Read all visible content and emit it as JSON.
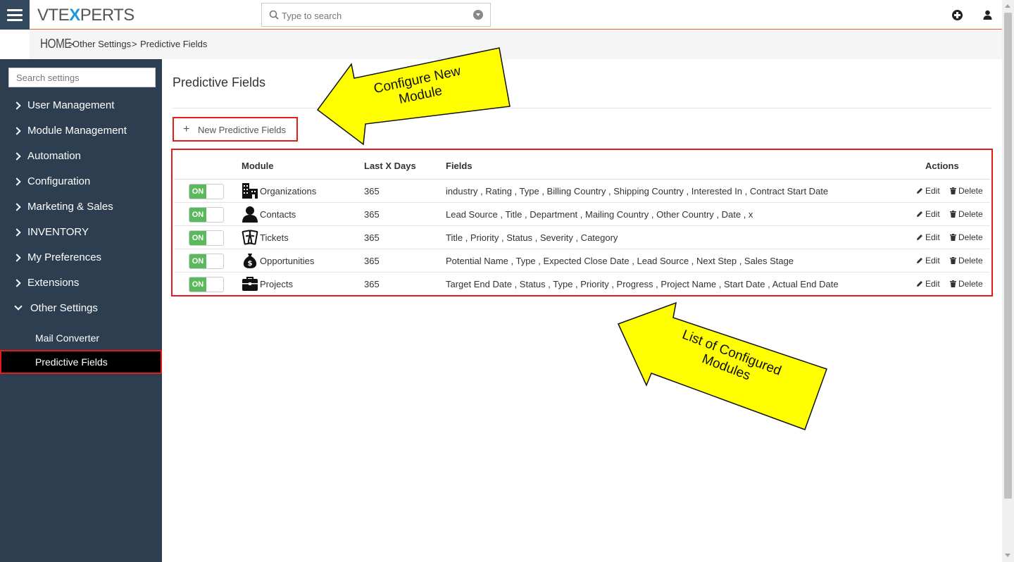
{
  "app": {
    "logo_left": "VTE",
    "logo_x": "X",
    "logo_right": "PERTS"
  },
  "search": {
    "placeholder": "Type to search"
  },
  "breadcrumb": {
    "home": "HOME",
    "sep": ">",
    "items": [
      "Other Settings",
      "Predictive Fields"
    ]
  },
  "sidebar": {
    "search_placeholder": "Search settings",
    "items": [
      {
        "label": "User Management"
      },
      {
        "label": "Module Management"
      },
      {
        "label": "Automation"
      },
      {
        "label": "Configuration"
      },
      {
        "label": "Marketing & Sales"
      },
      {
        "label": "INVENTORY"
      },
      {
        "label": "My Preferences"
      },
      {
        "label": "Extensions"
      },
      {
        "label": "Other Settings"
      }
    ],
    "subitems": [
      {
        "label": "Mail Converter"
      },
      {
        "label": "Predictive Fields"
      }
    ]
  },
  "main": {
    "title": "Predictive Fields",
    "new_button_icon": "+",
    "new_button": "New Predictive Fields",
    "columns": [
      "Module",
      "Last X Days",
      "Fields",
      "Actions"
    ],
    "rows": [
      {
        "status": "ON",
        "icon": "building-icon",
        "module": "Organizations",
        "days": "365",
        "fields": "industry , Rating , Type , Billing Country , Shipping Country , Interested In , Contract Start Date"
      },
      {
        "status": "ON",
        "icon": "person-icon",
        "module": "Contacts",
        "days": "365",
        "fields": "Lead Source , Title , Department , Mailing Country , Other Country , Date , x"
      },
      {
        "status": "ON",
        "icon": "ticket-icon",
        "module": "Tickets",
        "days": "365",
        "fields": "Title , Priority , Status , Severity , Category"
      },
      {
        "status": "ON",
        "icon": "money-bag-icon",
        "module": "Opportunities",
        "days": "365",
        "fields": "Potential Name , Type , Expected Close Date , Lead Source , Next Step , Sales Stage"
      },
      {
        "status": "ON",
        "icon": "briefcase-icon",
        "module": "Projects",
        "days": "365",
        "fields": "Target End Date , Status , Type , Priority , Progress , Project Name , Start Date , Actual End Date"
      }
    ],
    "edit_label": "Edit",
    "delete_label": "Delete"
  },
  "callouts": {
    "top_line1": "Configure New",
    "top_line2": "Module",
    "bottom_line1": "List of Configured",
    "bottom_line2": "Modules"
  },
  "colors": {
    "sidebar": "#2c3e50",
    "accent_orange": "#e9632e",
    "highlight_red": "#e41b17",
    "toggle_on": "#5cb85c",
    "callout_yellow": "#ffff00"
  }
}
